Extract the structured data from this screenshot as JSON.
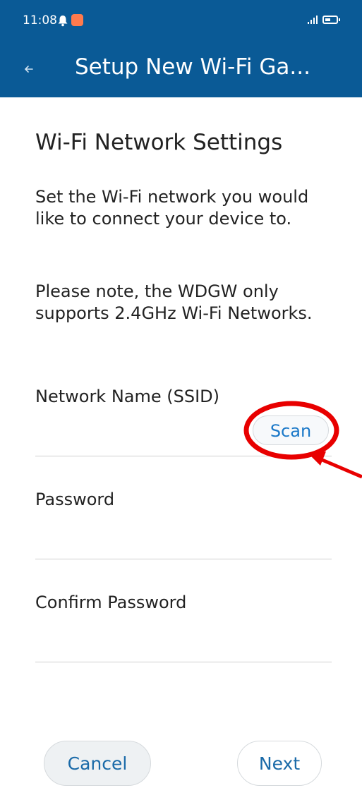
{
  "status_bar": {
    "time": "11:08",
    "icons": [
      "bell-icon",
      "app-notification-icon",
      "signal-icon",
      "battery-icon"
    ]
  },
  "app_bar": {
    "back_icon": "arrow-left-icon",
    "title": "Setup New Wi-Fi Ga..."
  },
  "page": {
    "section_title": "Wi-Fi Network Settings",
    "intro": "Set the Wi-Fi network you would like to connect your device to.",
    "note": "Please note, the WDGW only supports 2.4GHz Wi-Fi Networks."
  },
  "form": {
    "ssid_label": "Network Name (SSID)",
    "ssid_value": "",
    "scan_label": "Scan",
    "password_label": "Password",
    "password_value": "",
    "confirm_label": "Confirm Password",
    "confirm_value": ""
  },
  "actions": {
    "cancel_label": "Cancel",
    "next_label": "Next"
  },
  "colors": {
    "header_bg": "#0a5a96",
    "accent": "#1a78c8",
    "annotation": "#e80000"
  }
}
